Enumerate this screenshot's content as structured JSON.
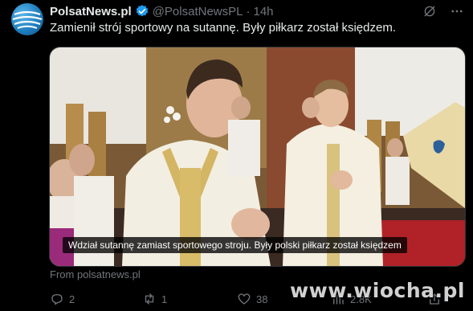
{
  "post": {
    "author_name": "PolsatNews.pl",
    "handle": "@PolsatNewsPL",
    "separator": "·",
    "time": "14h",
    "text": "Zamienił strój sportowy na sutannę. Były piłkarz został księdzem.",
    "media_caption": "Wdział sutannę zamiast sportowego stroju. Były polski piłkarz został księdzem",
    "source": "From polsatnews.pl"
  },
  "icons": {
    "avatar": "polsatnews-globe-logo",
    "verified": "verified-badge-icon",
    "grok": "grok-icon",
    "more": "more-icon",
    "reply": "reply-icon",
    "repost": "repost-icon",
    "like": "like-icon",
    "views": "views-icon",
    "share": "share-icon"
  },
  "stats": {
    "replies": "2",
    "reposts": "1",
    "likes": "38",
    "views": "2.8K"
  },
  "watermark": "www.wiocha.pl",
  "colors": {
    "background": "#000000",
    "text": "#e7e9ea",
    "muted": "#71767b",
    "verified": "#1d9bf0"
  }
}
